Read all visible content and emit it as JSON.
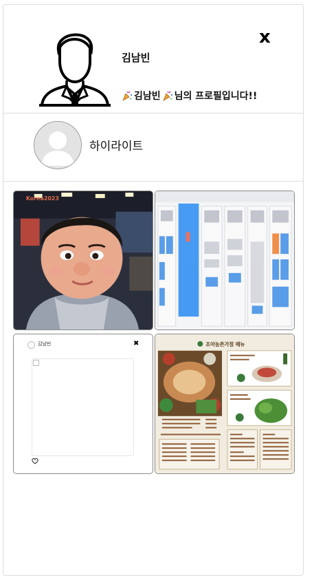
{
  "profile": {
    "username": "김남빈",
    "welcome_name": "김남빈",
    "welcome_suffix": "님의 프로필입니다!!",
    "close_label": "x"
  },
  "highlight": {
    "label": "하이라이트"
  },
  "posts": [
    {
      "kind": "photo",
      "overlay_text": "Korea2023"
    },
    {
      "kind": "screenshot"
    },
    {
      "kind": "mini-post",
      "author": "김남빈",
      "close_label": "✖"
    },
    {
      "kind": "menu",
      "title": "조아농촌가정 메뉴"
    }
  ]
}
